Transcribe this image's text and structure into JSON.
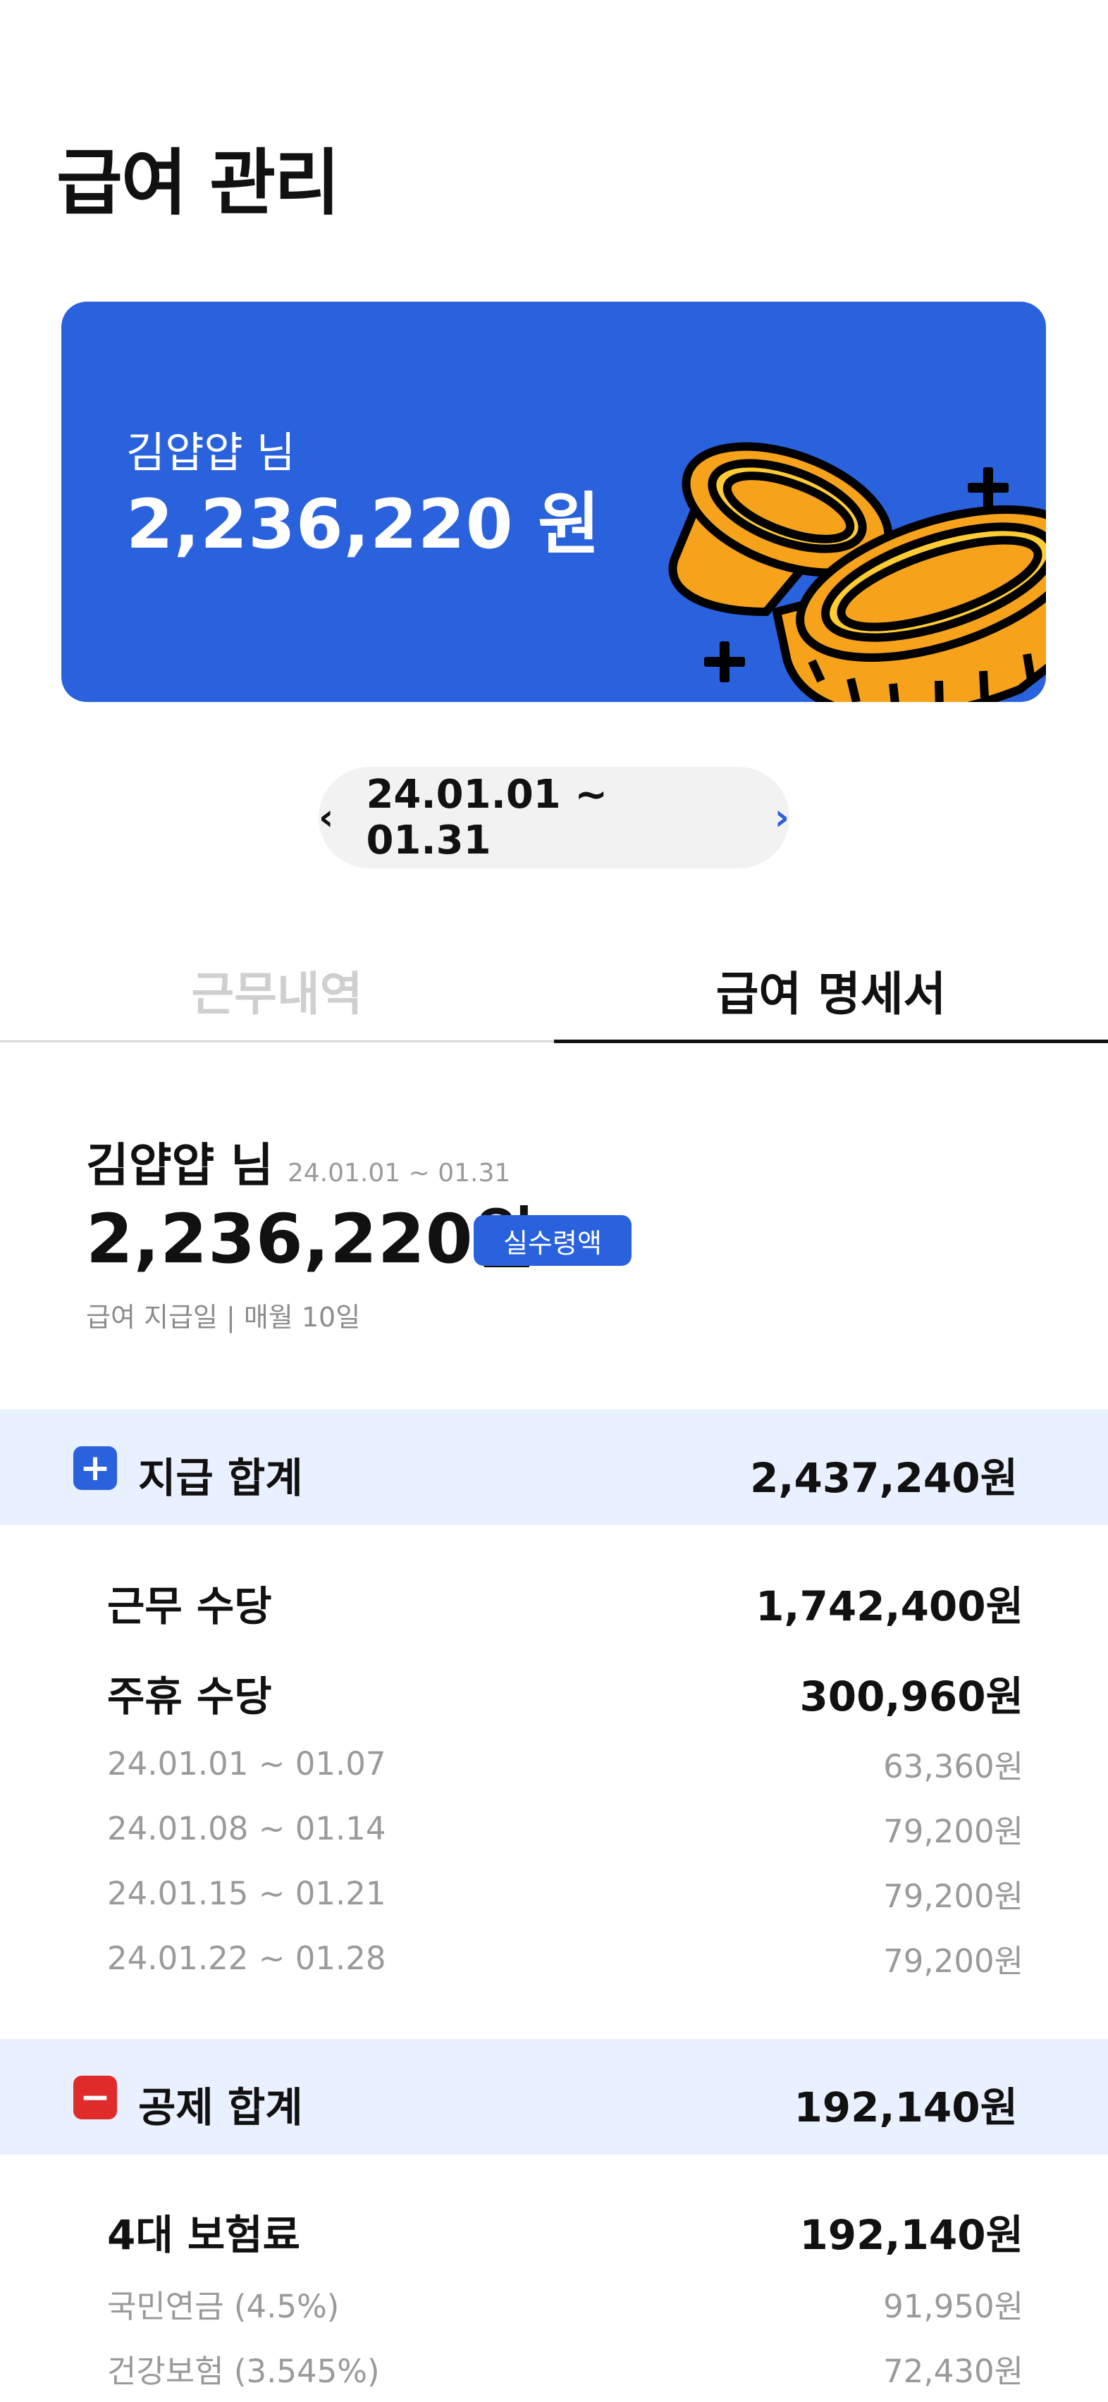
{
  "header": {
    "title": "급여 관리"
  },
  "hero": {
    "name": "김얍얍 님",
    "amount": "2,236,220 원"
  },
  "period": {
    "label": "24.01.01 ~ 01.31",
    "prev": "‹",
    "next": "›"
  },
  "tabs": [
    {
      "label": "근무내역",
      "active": false
    },
    {
      "label": "급여 명세서",
      "active": true
    }
  ],
  "summary": {
    "name": "김얍얍 님",
    "period": "24.01.01 ~ 01.31",
    "amount": "2,236,220원",
    "badge": "실수령액",
    "payday": "급여 지급일 | 매월 10일"
  },
  "payments": {
    "icon": "+",
    "label": "지급 합계",
    "total": "2,437,240원",
    "items": [
      {
        "label": "근무 수당",
        "value": "1,742,400원"
      },
      {
        "label": "주휴 수당",
        "value": "300,960원"
      }
    ],
    "weekly": [
      {
        "label": "24.01.01 ~ 01.07",
        "value": "63,360원"
      },
      {
        "label": "24.01.08 ~ 01.14",
        "value": "79,200원"
      },
      {
        "label": "24.01.15 ~ 01.21",
        "value": "79,200원"
      },
      {
        "label": "24.01.22 ~ 01.28",
        "value": "79,200원"
      }
    ]
  },
  "deductions": {
    "icon": "−",
    "label": "공제 합계",
    "total": "192,140원",
    "items": [
      {
        "label": "4대 보험료",
        "value": "192,140원"
      }
    ],
    "details": [
      {
        "label": "국민연금 (4.5%)",
        "value": "91,950원"
      },
      {
        "label": "건강보험 (3.545%)",
        "value": "72,430원"
      }
    ]
  },
  "colors": {
    "primary": "#2a62de",
    "band": "#e9f0ff",
    "minus": "#e02b2b",
    "coin": "#f7a21b"
  },
  "icons": {
    "prev": "chevron-left-icon",
    "next": "chevron-right-icon",
    "plus": "plus-square-icon",
    "minus": "minus-square-icon",
    "hero": "coins-icon"
  }
}
